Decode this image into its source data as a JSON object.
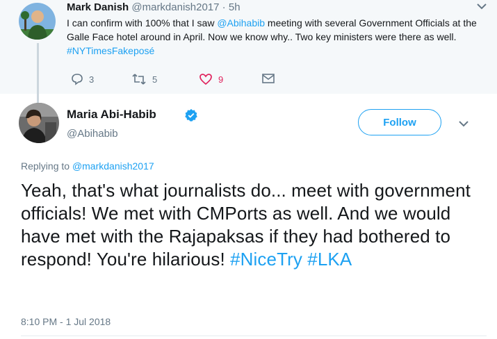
{
  "parent": {
    "name": "Mark Danish",
    "handle": "@markdanish2017",
    "sep": " · ",
    "time": "5h",
    "text_before": "I can confirm with 100% that I saw ",
    "mention": "@Abihabib",
    "text_after": " meeting with several Government Officials at the Galle Face hotel around in April. Now we know why..  Two key ministers were there as well. ",
    "hashtag": "#NYTimesFakeposé",
    "replies": "3",
    "retweets": "5",
    "likes": "9",
    "icons": [
      "reply-icon",
      "retweet-icon",
      "heart-icon",
      "mail-icon",
      "chevron-down-icon"
    ],
    "colors": {
      "like": "#e0245e",
      "icon": "#657786"
    }
  },
  "tweet": {
    "name": "Maria Abi-Habib",
    "handle": "@Abihabib",
    "follow_label": "Follow",
    "replying_prefix": "Replying to ",
    "replying_handle": "@markdanish2017",
    "text": "Yeah, that's what journalists do... meet with government officials! We met with CMPorts as well. And we would have met with the Rajapaksas if they had bothered to respond! You're hilarious! ",
    "hashtag1": "#NiceTry",
    "hashtag2": "#LKA",
    "timestamp": "8:10 PM - 1 Jul 2018",
    "icons": [
      "verified-icon",
      "chevron-down-icon"
    ],
    "colors": {
      "accent": "#1da1f2",
      "text": "#14171a",
      "muted": "#657786"
    }
  }
}
